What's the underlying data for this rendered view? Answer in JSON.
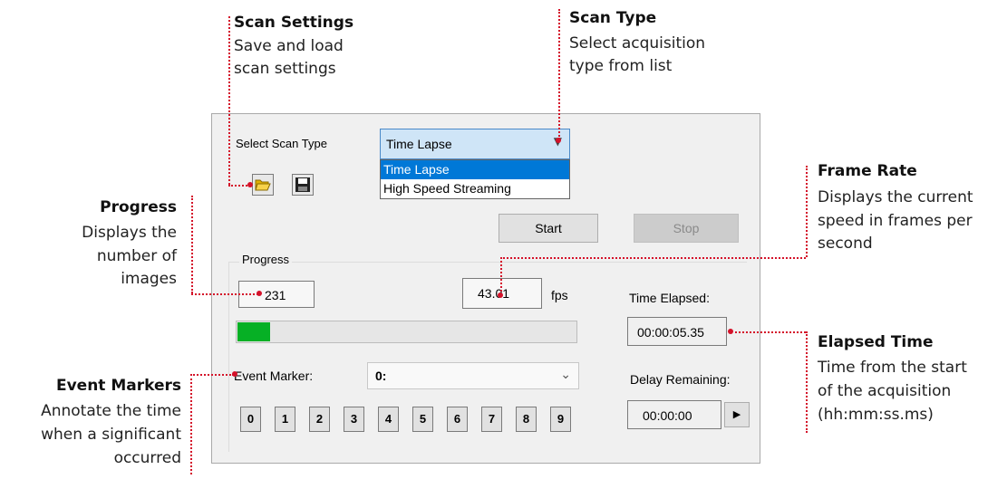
{
  "annotations": {
    "scan_settings": {
      "title": "Scan Settings",
      "lines": [
        "Save and load",
        "scan settings"
      ]
    },
    "scan_type": {
      "title": "Scan Type",
      "lines": [
        "Select acquisition",
        "type from list"
      ]
    },
    "frame_rate": {
      "title": "Frame Rate",
      "lines": [
        "Displays the current",
        "speed in frames per",
        "second"
      ]
    },
    "progress": {
      "title": "Progress",
      "lines": [
        "Displays the",
        "number of",
        "images"
      ]
    },
    "elapsed_time": {
      "title": "Elapsed Time",
      "lines": [
        "Time from the start",
        "of the acquisition",
        "(hh:mm:ss.ms)"
      ]
    },
    "event_markers": {
      "title": "Event Markers",
      "lines": [
        "Annotate the time",
        "when a significant",
        "occurred"
      ]
    }
  },
  "panel": {
    "select_scan_type_label": "Select Scan Type",
    "scan_type": {
      "selected": "Time Lapse",
      "options": [
        "Time Lapse",
        "High Speed Streaming"
      ]
    },
    "start_label": "Start",
    "stop_label": "Stop",
    "progress_group_label": "Progress",
    "progress_count": "231",
    "progress_fraction": 0.1,
    "fps_value": "43.01",
    "fps_unit": "fps",
    "time_elapsed_label": "Time Elapsed:",
    "time_elapsed_value": "00:00:05.35",
    "event_marker_label": "Event Marker:",
    "event_marker_value": "0:",
    "delay_remaining_label": "Delay Remaining:",
    "delay_remaining_value": "00:00:00",
    "marker_buttons": [
      "0",
      "1",
      "2",
      "3",
      "4",
      "5",
      "6",
      "7",
      "8",
      "9"
    ]
  },
  "colors": {
    "annotation_red": "#d4122a",
    "progress_green": "#06b025",
    "selection_blue": "#0078d7"
  },
  "icons": {
    "open": "folder-open-icon",
    "save": "save-disk-icon",
    "dropdown": "chevron-down-icon",
    "play": "play-arrow-icon"
  }
}
